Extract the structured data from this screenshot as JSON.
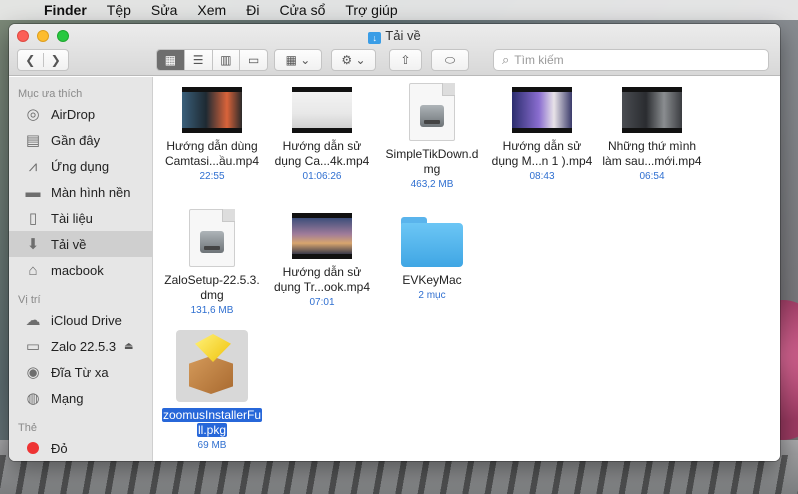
{
  "menubar": {
    "app": "Finder",
    "items": [
      "Tệp",
      "Sửa",
      "Xem",
      "Đi",
      "Cửa sổ",
      "Trợ giúp"
    ]
  },
  "window": {
    "title": "Tải về",
    "search_placeholder": "Tìm kiếm"
  },
  "sidebar": {
    "favorites_header": "Mục ưa thích",
    "favorites": [
      {
        "label": "AirDrop",
        "icon": "airdrop-icon"
      },
      {
        "label": "Gần đây",
        "icon": "recents-icon"
      },
      {
        "label": "Ứng dụng",
        "icon": "applications-icon"
      },
      {
        "label": "Màn hình nền",
        "icon": "desktop-icon"
      },
      {
        "label": "Tài liệu",
        "icon": "documents-icon"
      },
      {
        "label": "Tải về",
        "icon": "downloads-icon"
      },
      {
        "label": "macbook",
        "icon": "home-icon"
      }
    ],
    "locations_header": "Vị trí",
    "locations": [
      {
        "label": "iCloud Drive",
        "icon": "cloud-icon"
      },
      {
        "label": "Zalo 22.5.3",
        "icon": "disk-icon"
      },
      {
        "label": "Đĩa Từ xa",
        "icon": "remote-disc-icon"
      },
      {
        "label": "Mạng",
        "icon": "network-icon"
      }
    ],
    "tags_header": "Thẻ",
    "tags": [
      {
        "label": "Đỏ",
        "color": "#e33"
      }
    ]
  },
  "files": [
    {
      "name1": "Hướng dẫn dùng",
      "name2": "Camtasi...ầu.mp4",
      "meta": "22:55"
    },
    {
      "name1": "Hướng dẫn sử",
      "name2": "dụng Ca...4k.mp4",
      "meta": "01:06:26"
    },
    {
      "name1": "SimpleTikDown.d",
      "name2": "mg",
      "meta": "463,2 MB"
    },
    {
      "name1": "Hướng dẫn sử",
      "name2": "dụng M...n 1 ).mp4",
      "meta": "08:43"
    },
    {
      "name1": "Những thứ mình",
      "name2": "làm sau...mới.mp4",
      "meta": "06:54"
    },
    {
      "name1": "ZaloSetup-22.5.3.",
      "name2": "dmg",
      "meta": "131,6 MB"
    },
    {
      "name1": "Hướng dẫn sử",
      "name2": "dụng Tr...ook.mp4",
      "meta": "07:01"
    },
    {
      "name1": "EVKeyMac",
      "name2": "",
      "meta": "2 mục"
    },
    {
      "name1": "zoomusInstallerFu",
      "name2": "ll.pkg",
      "meta": "69 MB"
    }
  ]
}
